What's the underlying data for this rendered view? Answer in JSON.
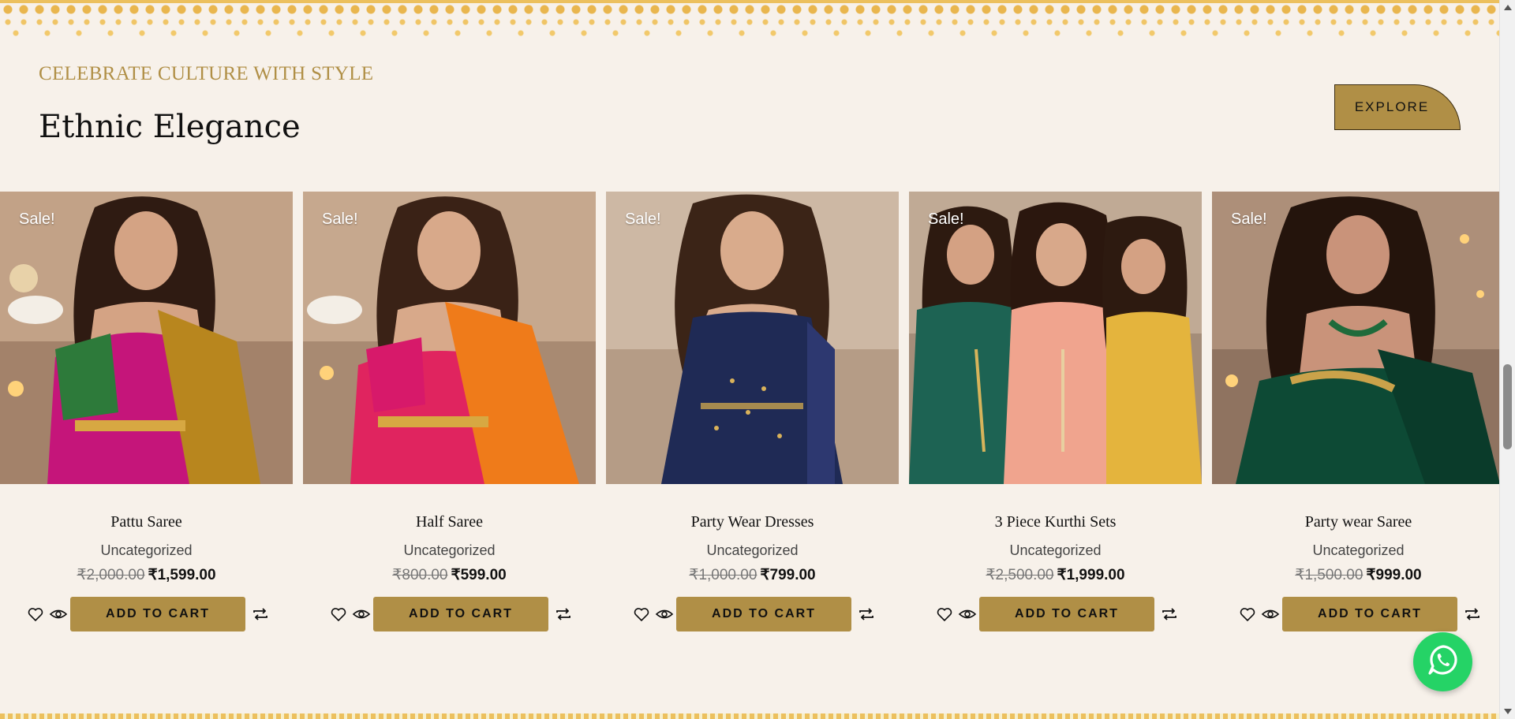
{
  "section": {
    "eyebrow": "CELEBRATE CULTURE WITH STYLE",
    "title": "Ethnic Elegance",
    "explore_label": "EXPLORE"
  },
  "products": [
    {
      "sale_badge": "Sale!",
      "name": "Pattu Saree",
      "category": "Uncategorized",
      "old_price": "₹2,000.00",
      "price": "₹1,599.00",
      "cart_label": "ADD TO CART"
    },
    {
      "sale_badge": "Sale!",
      "name": "Half Saree",
      "category": "Uncategorized",
      "old_price": "₹800.00",
      "price": "₹599.00",
      "cart_label": "ADD TO CART"
    },
    {
      "sale_badge": "Sale!",
      "name": "Party Wear Dresses",
      "category": "Uncategorized",
      "old_price": "₹1,000.00",
      "price": "₹799.00",
      "cart_label": "ADD TO CART"
    },
    {
      "sale_badge": "Sale!",
      "name": "3 Piece Kurthi Sets",
      "category": "Uncategorized",
      "old_price": "₹2,500.00",
      "price": "₹1,999.00",
      "cart_label": "ADD TO CART"
    },
    {
      "sale_badge": "Sale!",
      "name": "Party wear Saree",
      "category": "Uncategorized",
      "old_price": "₹1,500.00",
      "price": "₹999.00",
      "cart_label": "ADD TO CART"
    }
  ],
  "colors": {
    "accent": "#b08f46",
    "background": "#f7f1ea",
    "whatsapp": "#25d366"
  },
  "icons": {
    "wishlist": "heart-icon",
    "quick_view": "eye-icon",
    "compare": "compare-icon",
    "chat": "whatsapp-icon"
  }
}
